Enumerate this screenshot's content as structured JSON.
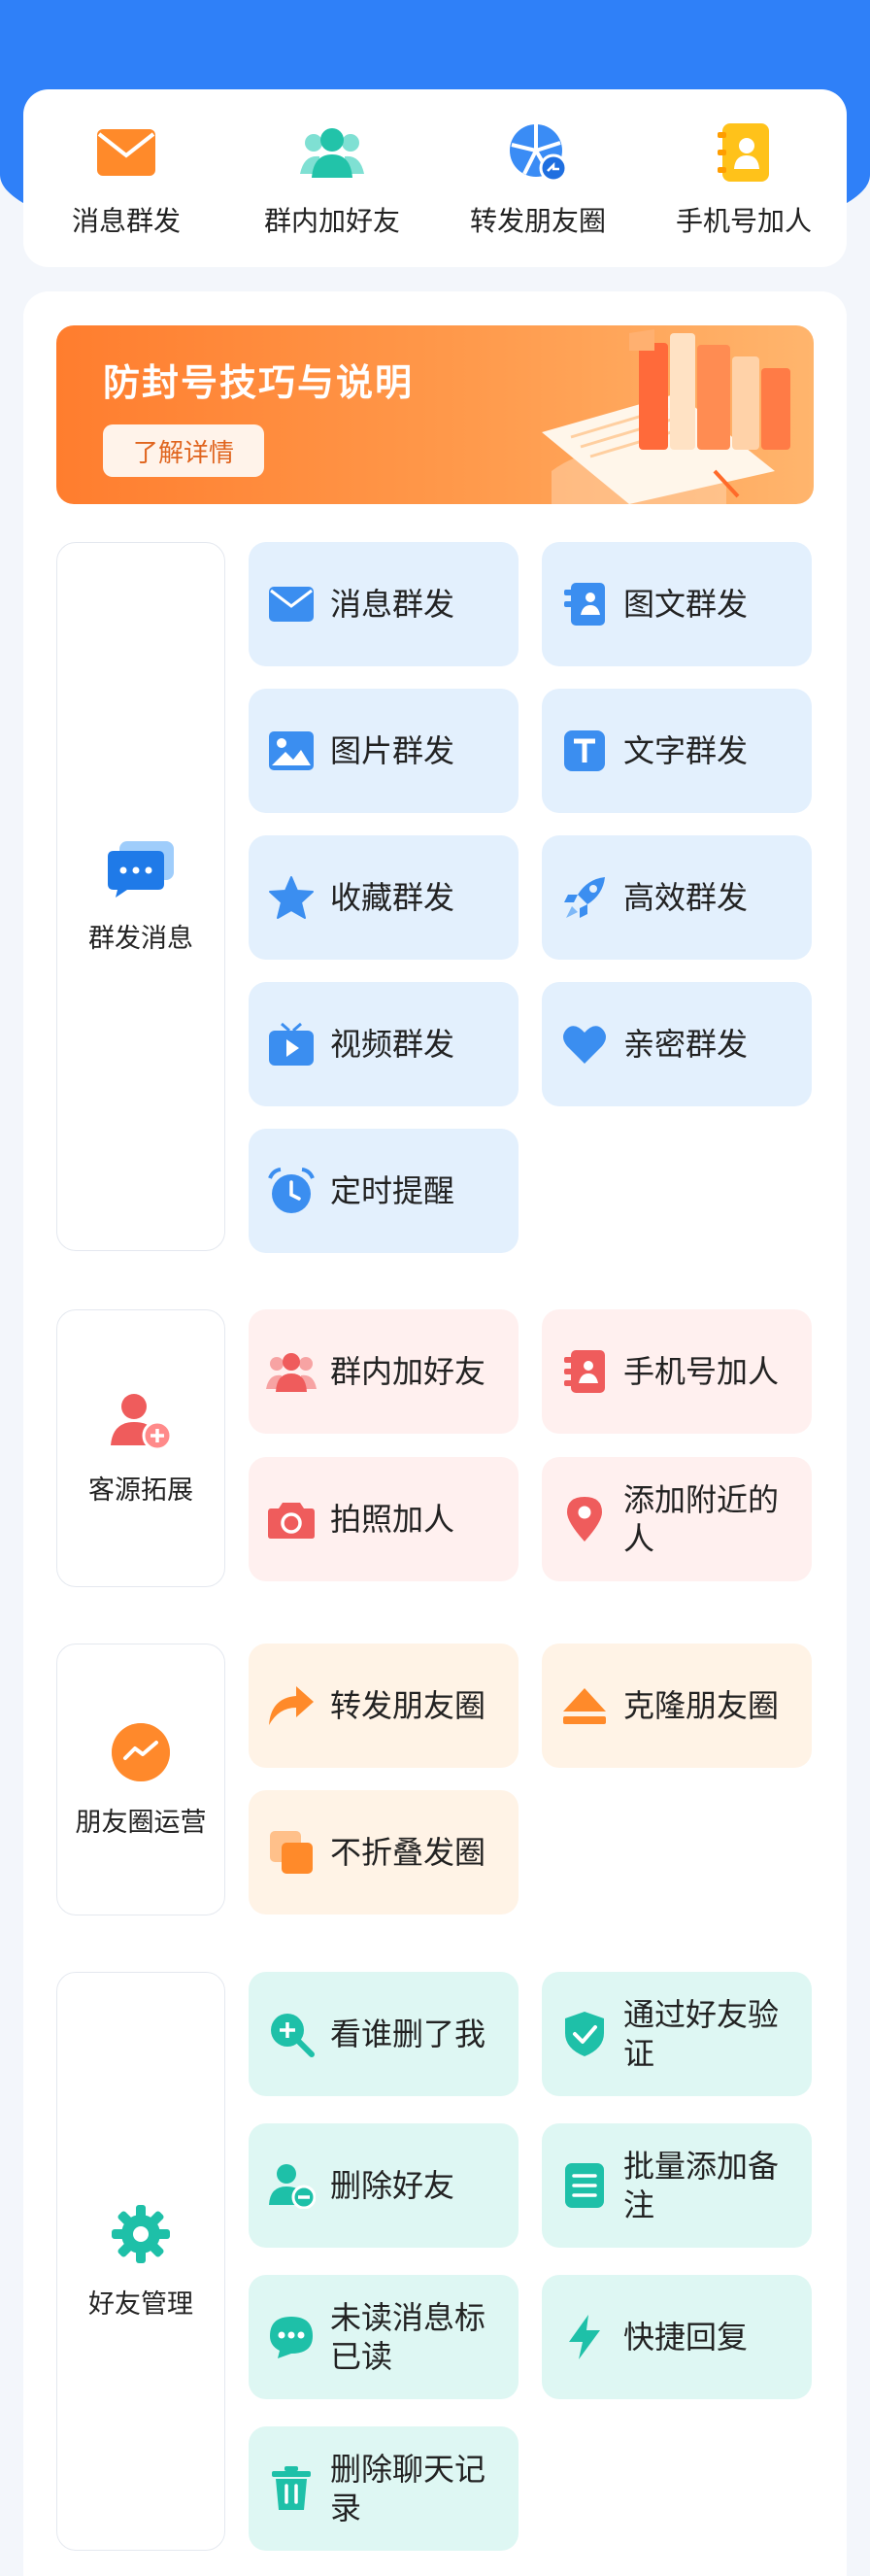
{
  "quick_actions": [
    {
      "label": "消息群发",
      "icon": "envelope-icon"
    },
    {
      "label": "群内加好友",
      "icon": "group-users-icon"
    },
    {
      "label": "转发朋友圈",
      "icon": "moments-share-icon"
    },
    {
      "label": "手机号加人",
      "icon": "contact-book-icon"
    }
  ],
  "banner": {
    "title": "防封号技巧与说明",
    "button": "了解详情"
  },
  "sections": [
    {
      "category": "群发消息",
      "icon": "chat-bubbles-icon",
      "items": [
        {
          "label": "消息群发",
          "icon": "envelope-icon"
        },
        {
          "label": "图文群发",
          "icon": "image-text-icon"
        },
        {
          "label": "图片群发",
          "icon": "picture-icon"
        },
        {
          "label": "文字群发",
          "icon": "text-t-icon"
        },
        {
          "label": "收藏群发",
          "icon": "star-icon"
        },
        {
          "label": "高效群发",
          "icon": "rocket-icon"
        },
        {
          "label": "视频群发",
          "icon": "video-tv-icon"
        },
        {
          "label": "亲密群发",
          "icon": "heart-icon"
        },
        {
          "label": "定时提醒",
          "icon": "alarm-clock-icon"
        }
      ]
    },
    {
      "category": "客源拓展",
      "icon": "add-user-icon",
      "items": [
        {
          "label": "群内加好友",
          "icon": "group-users-icon"
        },
        {
          "label": "手机号加人",
          "icon": "contact-book-icon"
        },
        {
          "label": "拍照加人",
          "icon": "camera-icon"
        },
        {
          "label": "添加附近的人",
          "icon": "location-pin-icon"
        }
      ]
    },
    {
      "category": "朋友圈运营",
      "icon": "trend-circle-icon",
      "items": [
        {
          "label": "转发朋友圈",
          "icon": "forward-arrow-icon"
        },
        {
          "label": "克隆朋友圈",
          "icon": "eject-icon"
        },
        {
          "label": "不折叠发圈",
          "icon": "stacked-squares-icon"
        }
      ]
    },
    {
      "category": "好友管理",
      "icon": "gear-icon",
      "items": [
        {
          "label": "看谁删了我",
          "icon": "search-plus-icon"
        },
        {
          "label": "通过好友验证",
          "icon": "shield-check-icon"
        },
        {
          "label": "删除好友",
          "icon": "remove-user-icon"
        },
        {
          "label": "批量添加备注",
          "icon": "note-list-icon"
        },
        {
          "label": "未读消息标已读",
          "icon": "chat-dots-icon"
        },
        {
          "label": "快捷回复",
          "icon": "lightning-icon"
        },
        {
          "label": "删除聊天记录",
          "icon": "trash-icon"
        }
      ]
    }
  ],
  "colors": {
    "header_blue": "#2f80f8",
    "blue_tile": "#e3f0fd",
    "pink_tile": "#fff0ef",
    "orange_tile": "#fff3e6",
    "teal_tile": "#def7f3",
    "banner_orange": "#ff7d2e"
  }
}
